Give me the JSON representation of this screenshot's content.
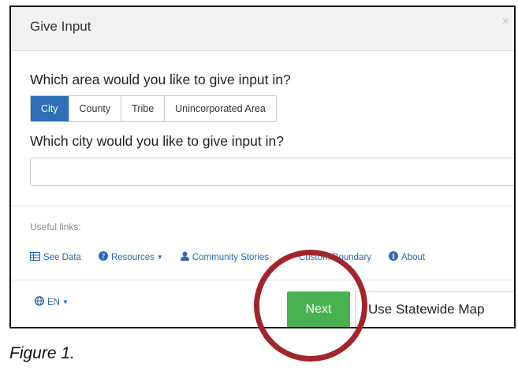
{
  "dialog": {
    "title": "Give Input",
    "close_glyph": "×",
    "question_area": "Which area would you like to give input in?",
    "area_options": [
      {
        "label": "City",
        "active": true
      },
      {
        "label": "County",
        "active": false
      },
      {
        "label": "Tribe",
        "active": false
      },
      {
        "label": "Unincorporated Area",
        "active": false
      }
    ],
    "question_city": "Which city would you like to give input in?",
    "city_input": {
      "value": "",
      "placeholder": ""
    },
    "useful_links_label": "Useful links:",
    "links": [
      {
        "label": "See Data",
        "icon": "table-icon"
      },
      {
        "label": "Resources",
        "icon": "question-circle-icon",
        "dropdown": true
      },
      {
        "label": "Community Stories",
        "icon": "user-icon"
      },
      {
        "label": "Custom Boundary",
        "icon": "pencil-icon"
      },
      {
        "label": "About",
        "icon": "info-circle-icon"
      }
    ],
    "language": {
      "label": "EN",
      "icon": "globe-icon"
    },
    "next_label": "Next",
    "statewide_label": "Use Statewide Map"
  },
  "annotation": {
    "color": "#a0262b"
  },
  "caption": "Figure 1.",
  "colors": {
    "primary": "#2f6fb5",
    "success": "#47b24f",
    "link": "#2a6ab3"
  }
}
